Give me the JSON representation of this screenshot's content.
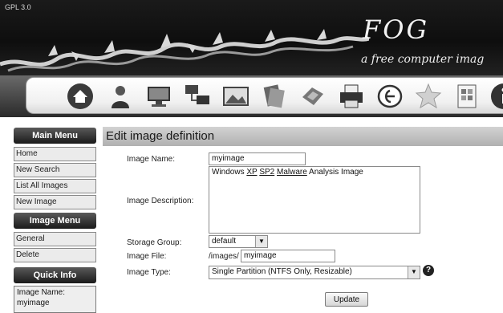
{
  "header": {
    "version": "GPL 3.0",
    "logo": "FOG",
    "tagline": "a free computer imag"
  },
  "toolbar": {
    "icons": [
      "home-icon",
      "users-icon",
      "computer-icon",
      "network-icon",
      "image-icon",
      "storage-icon",
      "snapin-icon",
      "printer-icon",
      "service-icon",
      "plugin-icon",
      "report-icon",
      "info-icon"
    ]
  },
  "sidebar": {
    "main_menu_title": "Main Menu",
    "main_menu": [
      "Home",
      "New Search",
      "List All Images",
      "New Image"
    ],
    "image_menu_title": "Image Menu",
    "image_menu": [
      "General",
      "Delete"
    ],
    "quick_info_title": "Quick Info",
    "quick_info_label": "Image Name:",
    "quick_info_value": "myimage"
  },
  "form": {
    "title": "Edit image definition",
    "image_name_label": "Image Name:",
    "image_name_value": "myimage",
    "description_label": "Image Description:",
    "description_parts": [
      "Windows ",
      "XP",
      " ",
      "SP2",
      " ",
      "Malware",
      " Analysis Image"
    ],
    "storage_label": "Storage Group:",
    "storage_value": "default",
    "file_label": "Image File:",
    "file_prefix": "/images/",
    "file_value": "myimage",
    "type_label": "Image Type:",
    "type_value": "Single Partition (NTFS Only, Resizable)",
    "help": "?",
    "update_label": "Update"
  }
}
